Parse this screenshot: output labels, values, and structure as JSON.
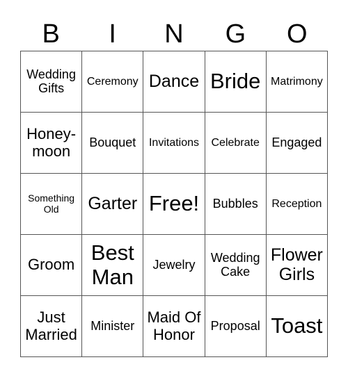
{
  "header": [
    "B",
    "I",
    "N",
    "G",
    "O"
  ],
  "cells": [
    {
      "text": "Wedding Gifts",
      "size": "md"
    },
    {
      "text": "Ceremony",
      "size": "sm"
    },
    {
      "text": "Dance",
      "size": "xl"
    },
    {
      "text": "Bride",
      "size": "xxl"
    },
    {
      "text": "Matrimony",
      "size": "sm"
    },
    {
      "text": "Honey-moon",
      "size": "lg"
    },
    {
      "text": "Bouquet",
      "size": "md"
    },
    {
      "text": "Invitations",
      "size": "sm"
    },
    {
      "text": "Celebrate",
      "size": "sm"
    },
    {
      "text": "Engaged",
      "size": "md"
    },
    {
      "text": "Something Old",
      "size": "xs"
    },
    {
      "text": "Garter",
      "size": "xl"
    },
    {
      "text": "Free!",
      "size": "xxl"
    },
    {
      "text": "Bubbles",
      "size": "md"
    },
    {
      "text": "Reception",
      "size": "sm"
    },
    {
      "text": "Groom",
      "size": "lg"
    },
    {
      "text": "Best Man",
      "size": "xxl"
    },
    {
      "text": "Jewelry",
      "size": "md"
    },
    {
      "text": "Wedding Cake",
      "size": "md"
    },
    {
      "text": "Flower Girls",
      "size": "xl"
    },
    {
      "text": "Just Married",
      "size": "lg"
    },
    {
      "text": "Minister",
      "size": "md"
    },
    {
      "text": "Maid Of Honor",
      "size": "lg"
    },
    {
      "text": "Proposal",
      "size": "md"
    },
    {
      "text": "Toast",
      "size": "xxl"
    }
  ]
}
